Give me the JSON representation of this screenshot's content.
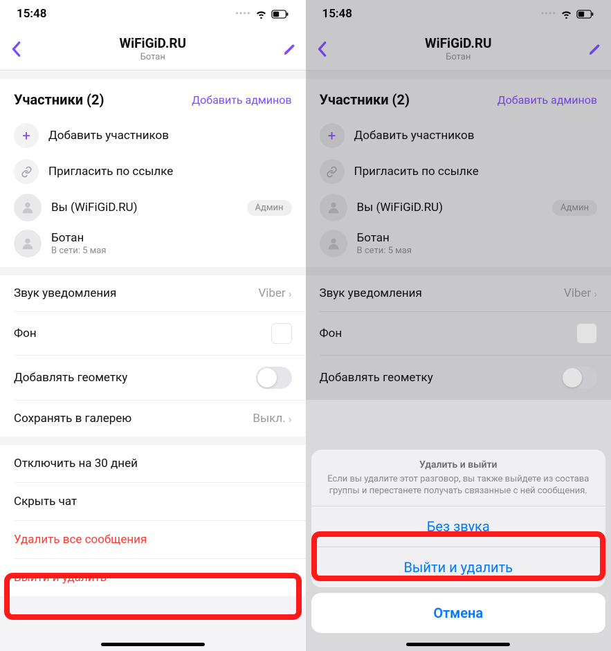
{
  "statusbar": {
    "time": "15:48"
  },
  "nav": {
    "title": "WiFiGiD.RU",
    "subtitle": "Ботан"
  },
  "participants": {
    "header": "Участники (2)",
    "add_admins": "Добавить админов",
    "add_members": "Добавить участников",
    "invite_link": "Пригласить по ссылке",
    "members": [
      {
        "name": "Вы (WiFiGiD.RU)",
        "sub": "",
        "badge": "Админ"
      },
      {
        "name": "Ботан",
        "sub": "В сети: 5 мая",
        "badge": ""
      }
    ]
  },
  "settings": {
    "notification_sound": {
      "label": "Звук уведомления",
      "value": "Viber"
    },
    "background": {
      "label": "Фон"
    },
    "geotag": {
      "label": "Добавлять геометку"
    },
    "save_gallery": {
      "label": "Сохранять в галерею",
      "value": "Выкл."
    }
  },
  "actions": {
    "snooze": "Отключить на 30 дней",
    "hide": "Скрыть чат",
    "delete_all": "Удалить все сообщения",
    "leave_delete": "Выйти и удалить"
  },
  "sheet": {
    "title": "Удалить и выйти",
    "description": "Если вы удалите этот разговор, вы также выйдете из состава группы и перестанете получать связанные с ней сообщения.",
    "mute": "Без звука",
    "leave": "Выйти и удалить",
    "cancel": "Отмена"
  }
}
